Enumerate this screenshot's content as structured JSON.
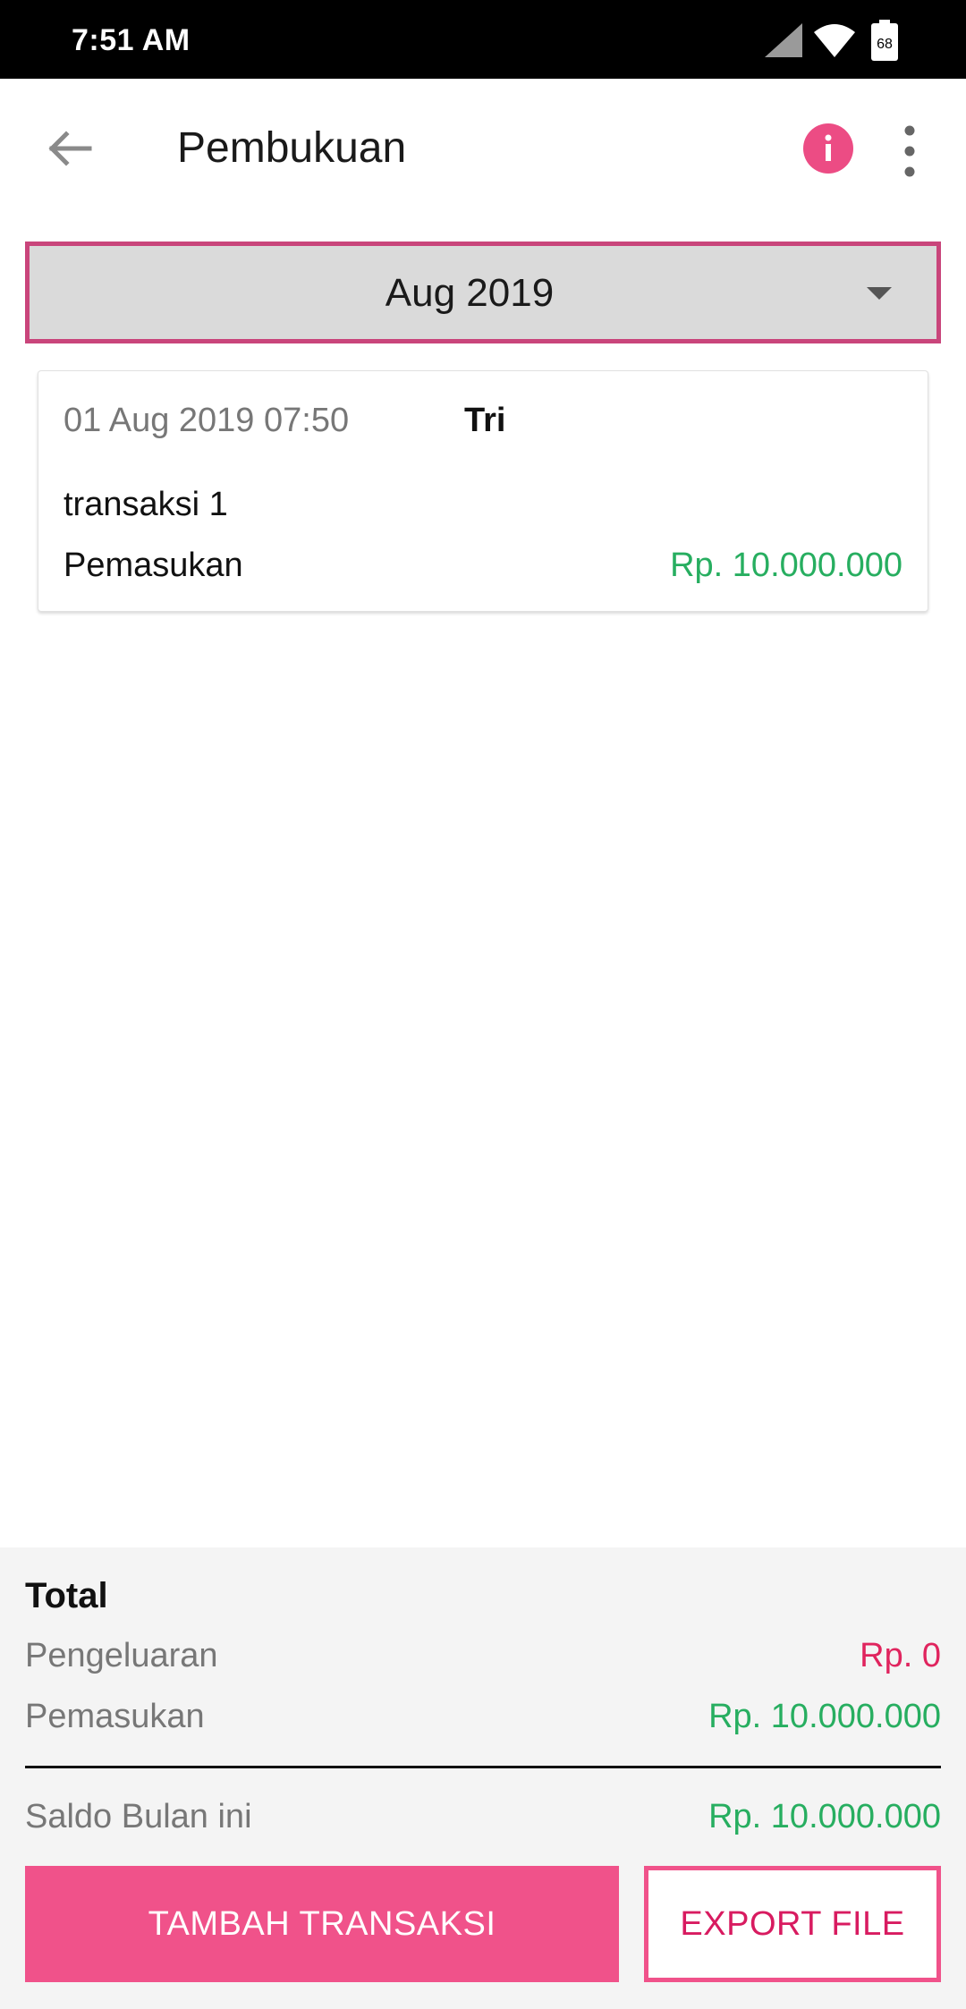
{
  "status_bar": {
    "time": "7:51 AM",
    "battery_level": "68",
    "icons": [
      "signal-icon",
      "wifi-icon",
      "battery-icon"
    ]
  },
  "app_bar": {
    "title": "Pembukuan",
    "icons": [
      "back-arrow-icon",
      "info-icon",
      "more-vert-icon"
    ]
  },
  "month_selector": {
    "value": "Aug 2019"
  },
  "transactions": [
    {
      "datetime": "01 Aug 2019 07:50",
      "user": "Tri",
      "description": "transaksi 1",
      "type": "Pemasukan",
      "amount": "Rp. 10.000.000"
    }
  ],
  "summary": {
    "title": "Total",
    "expense_label": "Pengeluaran",
    "expense_value": "Rp. 0",
    "income_label": "Pemasukan",
    "income_value": "Rp. 10.000.000",
    "balance_label": "Saldo Bulan ini",
    "balance_value": "Rp. 10.000.000"
  },
  "buttons": {
    "add_transaction": "TAMBAH TRANSAKSI",
    "export_file": "EXPORT FILE"
  },
  "colors": {
    "accent": "#f0528a",
    "accent_dark": "#d81b60",
    "income": "#27ae60",
    "expense": "#e0245e",
    "dropdown_border": "#c9457b"
  }
}
